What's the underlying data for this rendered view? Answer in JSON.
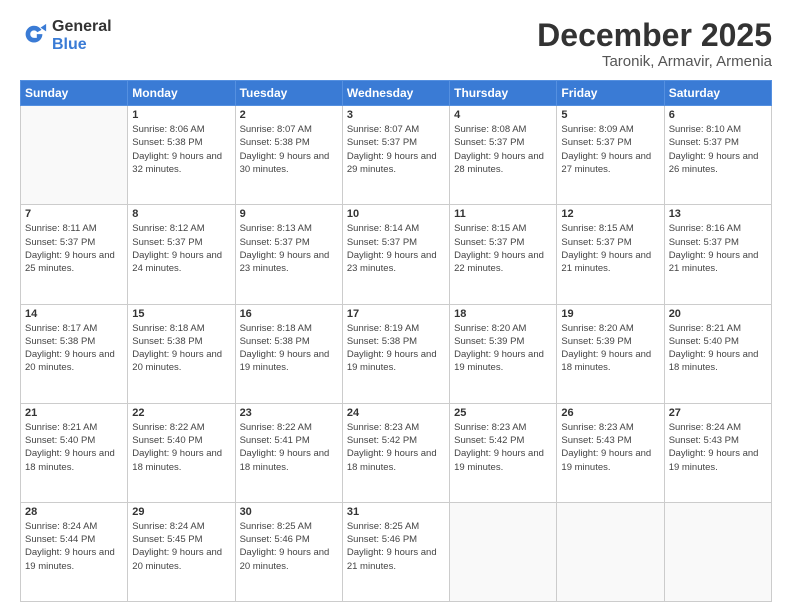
{
  "logo": {
    "general": "General",
    "blue": "Blue"
  },
  "title": "December 2025",
  "subtitle": "Taronik, Armavir, Armenia",
  "days_of_week": [
    "Sunday",
    "Monday",
    "Tuesday",
    "Wednesday",
    "Thursday",
    "Friday",
    "Saturday"
  ],
  "weeks": [
    [
      {
        "day": "",
        "sunrise": "",
        "sunset": "",
        "daylight": ""
      },
      {
        "day": "1",
        "sunrise": "Sunrise: 8:06 AM",
        "sunset": "Sunset: 5:38 PM",
        "daylight": "Daylight: 9 hours and 32 minutes."
      },
      {
        "day": "2",
        "sunrise": "Sunrise: 8:07 AM",
        "sunset": "Sunset: 5:38 PM",
        "daylight": "Daylight: 9 hours and 30 minutes."
      },
      {
        "day": "3",
        "sunrise": "Sunrise: 8:07 AM",
        "sunset": "Sunset: 5:37 PM",
        "daylight": "Daylight: 9 hours and 29 minutes."
      },
      {
        "day": "4",
        "sunrise": "Sunrise: 8:08 AM",
        "sunset": "Sunset: 5:37 PM",
        "daylight": "Daylight: 9 hours and 28 minutes."
      },
      {
        "day": "5",
        "sunrise": "Sunrise: 8:09 AM",
        "sunset": "Sunset: 5:37 PM",
        "daylight": "Daylight: 9 hours and 27 minutes."
      },
      {
        "day": "6",
        "sunrise": "Sunrise: 8:10 AM",
        "sunset": "Sunset: 5:37 PM",
        "daylight": "Daylight: 9 hours and 26 minutes."
      }
    ],
    [
      {
        "day": "7",
        "sunrise": "Sunrise: 8:11 AM",
        "sunset": "Sunset: 5:37 PM",
        "daylight": "Daylight: 9 hours and 25 minutes."
      },
      {
        "day": "8",
        "sunrise": "Sunrise: 8:12 AM",
        "sunset": "Sunset: 5:37 PM",
        "daylight": "Daylight: 9 hours and 24 minutes."
      },
      {
        "day": "9",
        "sunrise": "Sunrise: 8:13 AM",
        "sunset": "Sunset: 5:37 PM",
        "daylight": "Daylight: 9 hours and 23 minutes."
      },
      {
        "day": "10",
        "sunrise": "Sunrise: 8:14 AM",
        "sunset": "Sunset: 5:37 PM",
        "daylight": "Daylight: 9 hours and 23 minutes."
      },
      {
        "day": "11",
        "sunrise": "Sunrise: 8:15 AM",
        "sunset": "Sunset: 5:37 PM",
        "daylight": "Daylight: 9 hours and 22 minutes."
      },
      {
        "day": "12",
        "sunrise": "Sunrise: 8:15 AM",
        "sunset": "Sunset: 5:37 PM",
        "daylight": "Daylight: 9 hours and 21 minutes."
      },
      {
        "day": "13",
        "sunrise": "Sunrise: 8:16 AM",
        "sunset": "Sunset: 5:37 PM",
        "daylight": "Daylight: 9 hours and 21 minutes."
      }
    ],
    [
      {
        "day": "14",
        "sunrise": "Sunrise: 8:17 AM",
        "sunset": "Sunset: 5:38 PM",
        "daylight": "Daylight: 9 hours and 20 minutes."
      },
      {
        "day": "15",
        "sunrise": "Sunrise: 8:18 AM",
        "sunset": "Sunset: 5:38 PM",
        "daylight": "Daylight: 9 hours and 20 minutes."
      },
      {
        "day": "16",
        "sunrise": "Sunrise: 8:18 AM",
        "sunset": "Sunset: 5:38 PM",
        "daylight": "Daylight: 9 hours and 19 minutes."
      },
      {
        "day": "17",
        "sunrise": "Sunrise: 8:19 AM",
        "sunset": "Sunset: 5:38 PM",
        "daylight": "Daylight: 9 hours and 19 minutes."
      },
      {
        "day": "18",
        "sunrise": "Sunrise: 8:20 AM",
        "sunset": "Sunset: 5:39 PM",
        "daylight": "Daylight: 9 hours and 19 minutes."
      },
      {
        "day": "19",
        "sunrise": "Sunrise: 8:20 AM",
        "sunset": "Sunset: 5:39 PM",
        "daylight": "Daylight: 9 hours and 18 minutes."
      },
      {
        "day": "20",
        "sunrise": "Sunrise: 8:21 AM",
        "sunset": "Sunset: 5:40 PM",
        "daylight": "Daylight: 9 hours and 18 minutes."
      }
    ],
    [
      {
        "day": "21",
        "sunrise": "Sunrise: 8:21 AM",
        "sunset": "Sunset: 5:40 PM",
        "daylight": "Daylight: 9 hours and 18 minutes."
      },
      {
        "day": "22",
        "sunrise": "Sunrise: 8:22 AM",
        "sunset": "Sunset: 5:40 PM",
        "daylight": "Daylight: 9 hours and 18 minutes."
      },
      {
        "day": "23",
        "sunrise": "Sunrise: 8:22 AM",
        "sunset": "Sunset: 5:41 PM",
        "daylight": "Daylight: 9 hours and 18 minutes."
      },
      {
        "day": "24",
        "sunrise": "Sunrise: 8:23 AM",
        "sunset": "Sunset: 5:42 PM",
        "daylight": "Daylight: 9 hours and 18 minutes."
      },
      {
        "day": "25",
        "sunrise": "Sunrise: 8:23 AM",
        "sunset": "Sunset: 5:42 PM",
        "daylight": "Daylight: 9 hours and 19 minutes."
      },
      {
        "day": "26",
        "sunrise": "Sunrise: 8:23 AM",
        "sunset": "Sunset: 5:43 PM",
        "daylight": "Daylight: 9 hours and 19 minutes."
      },
      {
        "day": "27",
        "sunrise": "Sunrise: 8:24 AM",
        "sunset": "Sunset: 5:43 PM",
        "daylight": "Daylight: 9 hours and 19 minutes."
      }
    ],
    [
      {
        "day": "28",
        "sunrise": "Sunrise: 8:24 AM",
        "sunset": "Sunset: 5:44 PM",
        "daylight": "Daylight: 9 hours and 19 minutes."
      },
      {
        "day": "29",
        "sunrise": "Sunrise: 8:24 AM",
        "sunset": "Sunset: 5:45 PM",
        "daylight": "Daylight: 9 hours and 20 minutes."
      },
      {
        "day": "30",
        "sunrise": "Sunrise: 8:25 AM",
        "sunset": "Sunset: 5:46 PM",
        "daylight": "Daylight: 9 hours and 20 minutes."
      },
      {
        "day": "31",
        "sunrise": "Sunrise: 8:25 AM",
        "sunset": "Sunset: 5:46 PM",
        "daylight": "Daylight: 9 hours and 21 minutes."
      },
      {
        "day": "",
        "sunrise": "",
        "sunset": "",
        "daylight": ""
      },
      {
        "day": "",
        "sunrise": "",
        "sunset": "",
        "daylight": ""
      },
      {
        "day": "",
        "sunrise": "",
        "sunset": "",
        "daylight": ""
      }
    ]
  ]
}
